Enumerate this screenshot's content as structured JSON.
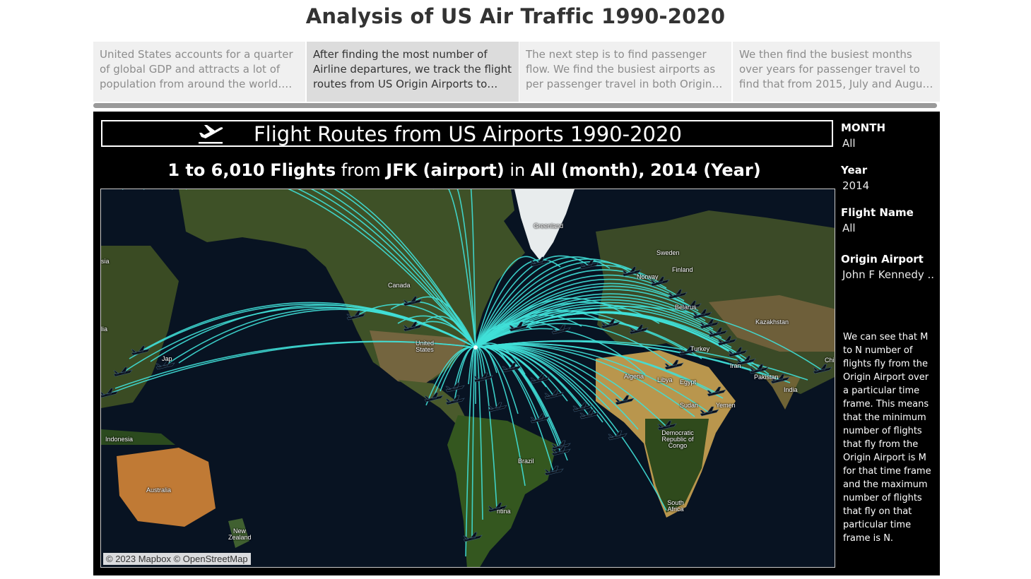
{
  "page": {
    "title": "Analysis of US Air Traffic 1990-2020"
  },
  "story_points": [
    {
      "text": "United States accounts for a quarter of global GDP and attracts a lot of population from around the world. Th..",
      "active": false
    },
    {
      "text": "After finding the most number of Airline departures, we track the flight routes from US Origin Airports to Des..",
      "active": true
    },
    {
      "text": "The next step is to find passenger flow. We find the busiest airports as per passenger travel in both Origin an..",
      "active": false
    },
    {
      "text": "We then find the busiest months over years for passenger travel to find that from 2015, July and August have be..",
      "active": false
    }
  ],
  "dashboard": {
    "title": "Flight Routes from US Airports 1990-2020",
    "title_icon": "airplane-departure-icon",
    "subtitle": {
      "range": "1 to 6,010",
      "w_flights": "Flights",
      "w_from": "from",
      "airport": "JFK (airport)",
      "w_in": "in",
      "month": "All (month),",
      "year": "2014 (Year)"
    },
    "map": {
      "attribution": "© 2023 Mapbox © OpenStreetMap",
      "labels": {
        "greenland": "Greenland",
        "sweden": "Sweden",
        "finland": "Finland",
        "norway": "Norway",
        "canada": "Canada",
        "united_states": "United States",
        "belarus": "Belarus",
        "kazakhstan": "Kazakhstan",
        "turkey": "Turkey",
        "algeria": "Algeria",
        "libya": "Libya",
        "egypt": "Egypt",
        "sudan": "Sudan",
        "yemen": "Yemen",
        "pakistan": "Pakistan",
        "india": "India",
        "dr_congo": "Democratic Republic of Congo",
        "brazil": "Brazil",
        "south_africa": "South Africa",
        "indonesia": "Indonesia",
        "australia": "Australia",
        "new_zealand": "New Zealand",
        "japan": "Jap",
        "asia": "sia",
        "edge_left": "lia",
        "edge_right": "Chi",
        "argentina": "ntina",
        "iran": "Iran"
      },
      "origin": "JFK",
      "route_color": "#40e0d8"
    },
    "filters": [
      {
        "label": "MONTH",
        "value": "All"
      },
      {
        "label": "Year",
        "value": "2014"
      },
      {
        "label": "Flight Name",
        "value": "All"
      },
      {
        "label": "Origin Airport",
        "value": "John F Kennedy .."
      }
    ],
    "explanation": "We can see that M to N number of flights fly from the Origin Airport over a particular time frame. This means that the minimum number of flights that fly from the Origin Airport  is M for that time frame and the maximum number of flights that fly on that particular time frame is N."
  }
}
